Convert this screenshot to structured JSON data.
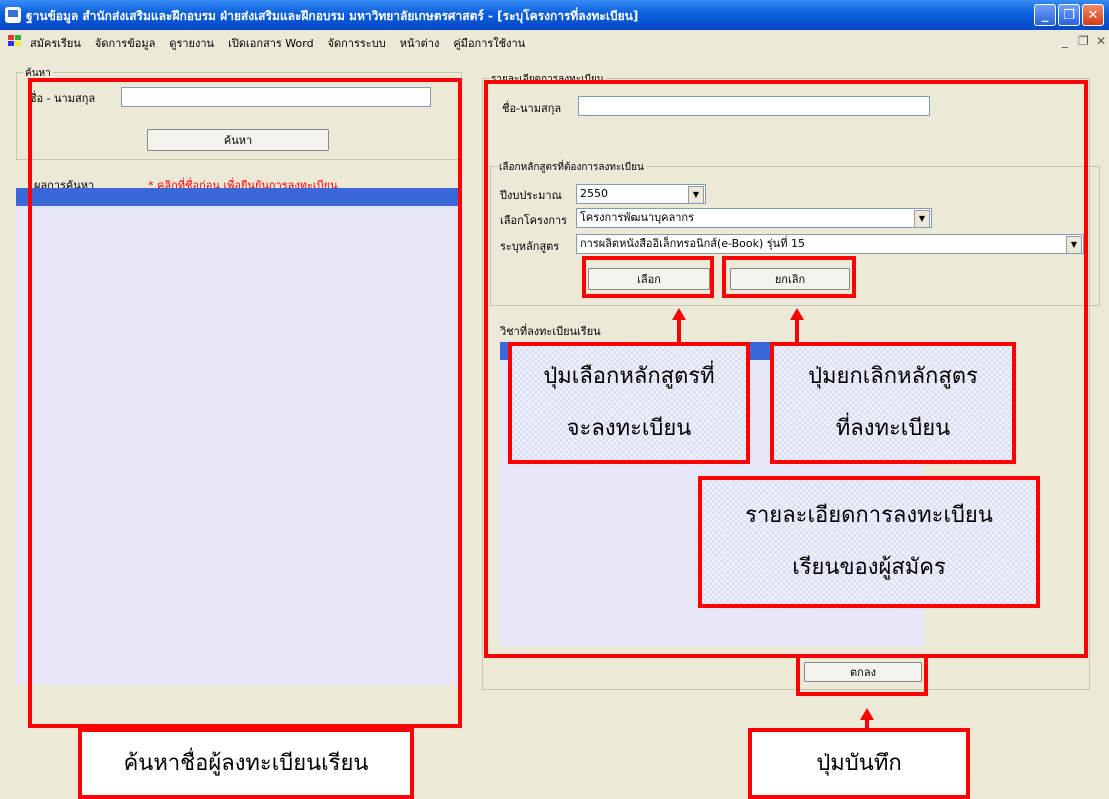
{
  "window": {
    "title": "ฐานข้อมูล สำนักส่งเสริมและฝึกอบรม ฝ่ายส่งเสริมและฝึกอบรม มหาวิทยาลัยเกษตรศาสตร์ - [ระบุโครงการที่ลงทะเบียน]"
  },
  "menu": {
    "items": [
      "สมัครเรียน",
      "จัดการข้อมูล",
      "ดูรายงาน",
      "เปิดเอกสาร Word",
      "จัดการระบบ",
      "หน้าต่าง",
      "คู่มือการใช้งาน"
    ]
  },
  "search": {
    "group_label": "ค้นหา",
    "name_label": "ชื่อ - นามสกุล",
    "name_value": "",
    "search_button": "ค้นหา",
    "results_label": "ผลการค้นหา",
    "results_hint": "* คลิกที่ชื่อก่อน เพื่อยืนยันการลงทะเบียน",
    "hint_color": "#ff0000"
  },
  "details": {
    "group_label": "รายละเอียดการลงทะเบียน",
    "name_label": "ชื่อ-นามสกุล",
    "name_value": "",
    "course_group_label": "เลือกหลักสูตรที่ต้องการลงทะเบียน",
    "budget_label": "ปีงบประมาณ",
    "budget_value": "2550",
    "project_label": "เลือกโครงการ",
    "project_value": "โครงการพัฒนาบุคลากร",
    "course_label": "ระบุหลักสูตร",
    "course_value": "การผลิตหนังสืออิเล็กทรอนิกส์(e-Book) รุ่นที่ 15",
    "select_button": "เลือก",
    "cancel_button": "ยกเลิก",
    "registered_label": "วิชาที่ลงทะเบียนเรียน",
    "ok_button": "ตกลง"
  },
  "annotations": {
    "select_callout_1": "ปุ่มเลือกหลักสูตรที่",
    "select_callout_2": "จะลงทะเบียน",
    "cancel_callout_1": "ปุ่มยกเลิกหลักสูตร",
    "cancel_callout_2": "ที่ลงทะเบียน",
    "detail_callout_1": "รายละเอียดการลงทะเบียน",
    "detail_callout_2": "เรียนของผู้สมัคร",
    "search_callout": "ค้นหาชื่อผู้ลงทะเบียนเรียน",
    "save_callout": "ปุ่มบันทึก",
    "annotation_color": "#ff0000"
  }
}
